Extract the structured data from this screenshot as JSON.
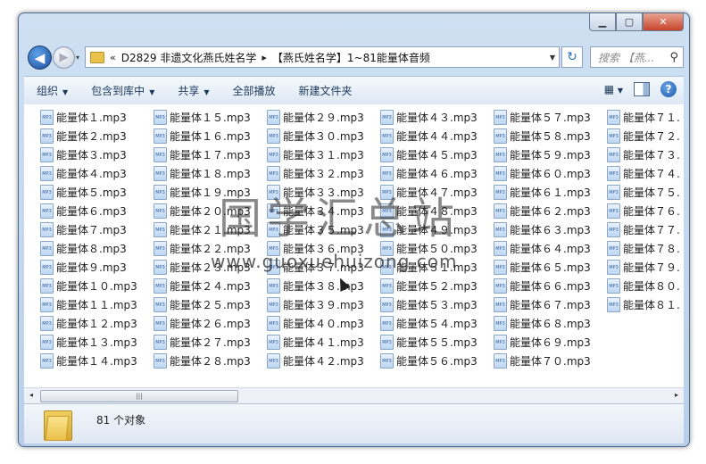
{
  "window": {
    "controls": {
      "minimize": "▁",
      "maximize": "▢",
      "close": "✕"
    }
  },
  "nav": {
    "back_glyph": "◀",
    "forward_glyph": "▶",
    "recent_glyph": "▾",
    "chevrons": "«",
    "path": [
      "D2829 非遗文化燕氏姓名学",
      "【燕氏姓名学】1~81能量体音频"
    ],
    "separator": "▸",
    "refresh_glyph": "↻",
    "search_placeholder": "搜索 【燕...",
    "search_icon": "⚲"
  },
  "toolbar": {
    "organize": "组织",
    "include_in_library": "包含到库中",
    "share": "共享",
    "play_all": "全部播放",
    "new_folder": "新建文件夹",
    "help": "?",
    "arrow": "▼"
  },
  "files": {
    "icon_label": "MP3",
    "items": [
      "能量体１.mp3",
      "能量体２.mp3",
      "能量体３.mp3",
      "能量体４.mp3",
      "能量体５.mp3",
      "能量体６.mp3",
      "能量体７.mp3",
      "能量体８.mp3",
      "能量体９.mp3",
      "能量体１０.mp3",
      "能量体１１.mp3",
      "能量体１２.mp3",
      "能量体１３.mp3",
      "能量体１４.mp3",
      "能量体１５.mp3",
      "能量体１６.mp3",
      "能量体１７.mp3",
      "能量体１８.mp3",
      "能量体１９.mp3",
      "能量体２０.mp3",
      "能量体２１.mp3",
      "能量体２２.mp3",
      "能量体２３.mp3",
      "能量体２４.mp3",
      "能量体２５.mp3",
      "能量体２６.mp3",
      "能量体２７.mp3",
      "能量体２８.mp3",
      "能量体２９.mp3",
      "能量体３０.mp3",
      "能量体３１.mp3",
      "能量体３２.mp3",
      "能量体３３.mp3",
      "能量体３４.mp3",
      "能量体３５.mp3",
      "能量体３６.mp3",
      "能量体３７.mp3",
      "能量体３８.mp3",
      "能量体３９.mp3",
      "能量体４０.mp3",
      "能量体４１.mp3",
      "能量体４２.mp3",
      "能量体４３.mp3",
      "能量体４４.mp3",
      "能量体４５.mp3",
      "能量体４６.mp3",
      "能量体４７.mp3",
      "能量体４８.mp3",
      "能量体４９.mp3",
      "能量体５０.mp3",
      "能量体５１.mp3",
      "能量体５２.mp3",
      "能量体５３.mp3",
      "能量体５４.mp3",
      "能量体５５.mp3",
      "能量体５６.mp3",
      "能量体５７.mp3",
      "能量体５８.mp3",
      "能量体５９.mp3",
      "能量体６０.mp3",
      "能量体６１.mp3",
      "能量体６２.mp3",
      "能量体６３.mp3",
      "能量体６４.mp3",
      "能量体６５.mp3",
      "能量体６６.mp3",
      "能量体６７.mp3",
      "能量体６８.mp3",
      "能量体６９.mp3",
      "能量体７０.mp3",
      "能量体７１.",
      "能量体７２.",
      "能量体７３.",
      "能量体７４.",
      "能量体７５.",
      "能量体７６.",
      "能量体７７.",
      "能量体７８.",
      "能量体７９.",
      "能量体８０.",
      "能量体８１."
    ]
  },
  "scrollbar": {
    "left": "◂",
    "right": "▸",
    "thumb_grip": "|||"
  },
  "details": {
    "count": "81 个对象"
  },
  "watermark": {
    "text_cn": "国学汇总站",
    "text_url": "www.guoxuehuizong.com"
  }
}
